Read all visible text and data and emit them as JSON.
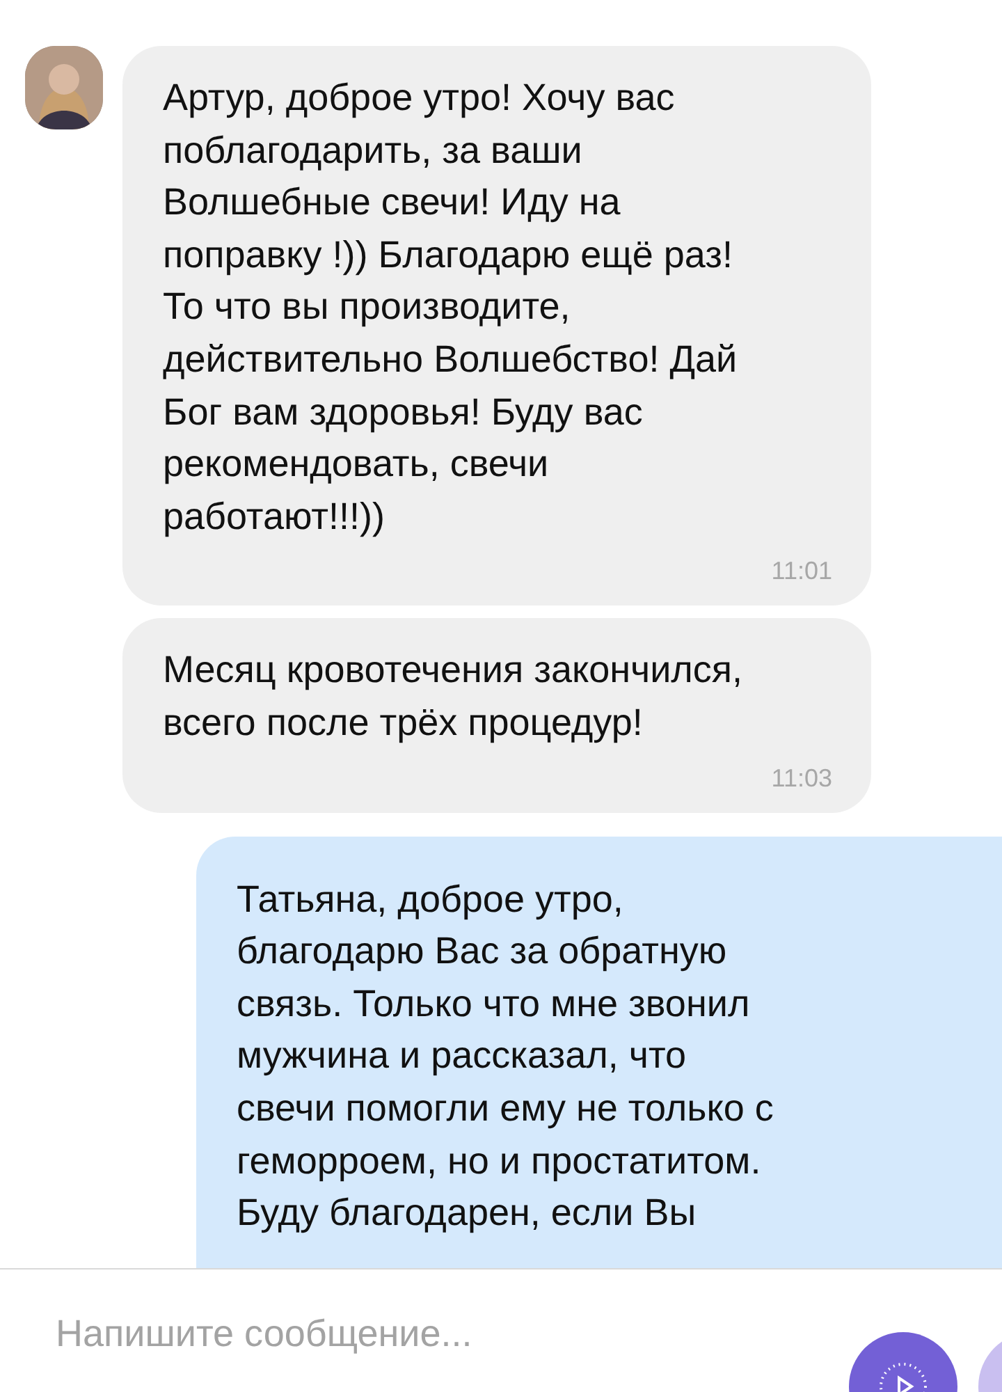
{
  "messages": [
    {
      "kind": "incoming",
      "avatar": true,
      "text": "Артур, доброе утро! Хочу вас\nпоблагодарить, за ваши\nВолшебные свечи! Иду на\nпоправку !)) Благодарю ещё раз!\nТо что вы производите,\nдействительно Волшебство! Дай\nБог вам здоровья! Буду вас\nрекомендовать, свечи\nработают!!!))",
      "time": "11:01"
    },
    {
      "kind": "incoming",
      "avatar": false,
      "text": "Месяц кровотечения закончился,\nвсего после трёх процедур!",
      "time": "11:03"
    },
    {
      "kind": "outgoing",
      "text": "Татьяна, доброе утро,\nблагодарю Вас за обратную\nсвязь. Только что мне звонил\nмужчина и рассказал, что\nсвечи помогли ему не только с\nгеморроем, но и простатитом.\nБуду благодарен, если Вы"
    }
  ],
  "composer": {
    "placeholder": "Напишите сообщение..."
  }
}
